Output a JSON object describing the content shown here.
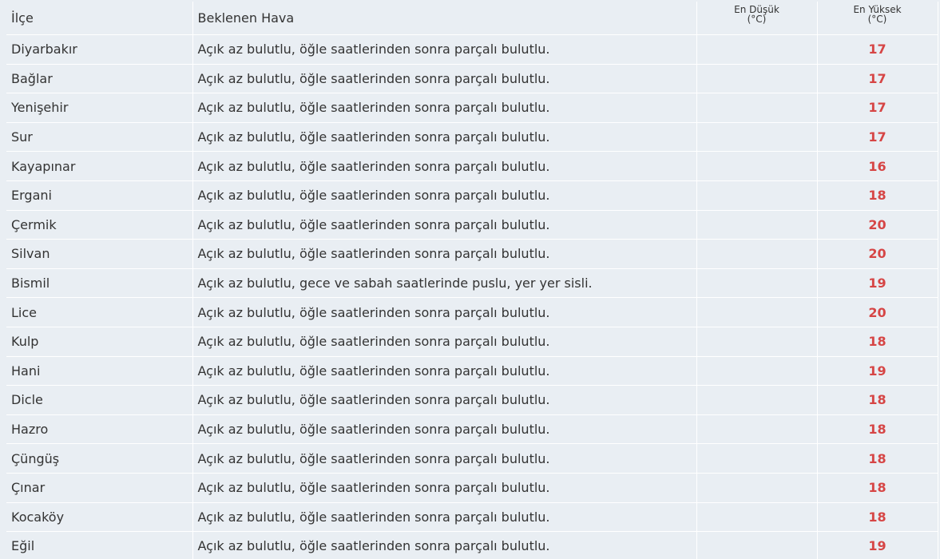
{
  "table": {
    "headers": {
      "ilce": "İlçe",
      "hava": "Beklenen Hava",
      "min_line1": "En Düşük",
      "min_line2": "(°C)",
      "max_line1": "En Yüksek",
      "max_line2": "(°C)"
    },
    "rows": [
      {
        "ilce": "Diyarbakır",
        "hava": "Açık az bulutlu, öğle saatlerinden sonra parçalı bulutlu.",
        "min": "",
        "max": "17"
      },
      {
        "ilce": "Bağlar",
        "hava": "Açık az bulutlu, öğle saatlerinden sonra parçalı bulutlu.",
        "min": "",
        "max": "17"
      },
      {
        "ilce": "Yenişehir",
        "hava": "Açık az bulutlu, öğle saatlerinden sonra parçalı bulutlu.",
        "min": "",
        "max": "17"
      },
      {
        "ilce": "Sur",
        "hava": "Açık az bulutlu, öğle saatlerinden sonra parçalı bulutlu.",
        "min": "",
        "max": "17"
      },
      {
        "ilce": "Kayapınar",
        "hava": "Açık az bulutlu, öğle saatlerinden sonra parçalı bulutlu.",
        "min": "",
        "max": "16"
      },
      {
        "ilce": "Ergani",
        "hava": "Açık az bulutlu, öğle saatlerinden sonra parçalı bulutlu.",
        "min": "",
        "max": "18"
      },
      {
        "ilce": "Çermik",
        "hava": "Açık az bulutlu, öğle saatlerinden sonra parçalı bulutlu.",
        "min": "",
        "max": "20"
      },
      {
        "ilce": "Silvan",
        "hava": "Açık az bulutlu, öğle saatlerinden sonra parçalı bulutlu.",
        "min": "",
        "max": "20"
      },
      {
        "ilce": "Bismil",
        "hava": "Açık az bulutlu, gece ve sabah saatlerinde puslu, yer yer sisli.",
        "min": "",
        "max": "19"
      },
      {
        "ilce": "Lice",
        "hava": "Açık az bulutlu, öğle saatlerinden sonra parçalı bulutlu.",
        "min": "",
        "max": "20"
      },
      {
        "ilce": "Kulp",
        "hava": "Açık az bulutlu, öğle saatlerinden sonra parçalı bulutlu.",
        "min": "",
        "max": "18"
      },
      {
        "ilce": "Hani",
        "hava": "Açık az bulutlu, öğle saatlerinden sonra parçalı bulutlu.",
        "min": "",
        "max": "19"
      },
      {
        "ilce": "Dicle",
        "hava": "Açık az bulutlu, öğle saatlerinden sonra parçalı bulutlu.",
        "min": "",
        "max": "18"
      },
      {
        "ilce": "Hazro",
        "hava": "Açık az bulutlu, öğle saatlerinden sonra parçalı bulutlu.",
        "min": "",
        "max": "18"
      },
      {
        "ilce": "Çüngüş",
        "hava": "Açık az bulutlu, öğle saatlerinden sonra parçalı bulutlu.",
        "min": "",
        "max": "18"
      },
      {
        "ilce": "Çınar",
        "hava": "Açık az bulutlu, öğle saatlerinden sonra parçalı bulutlu.",
        "min": "",
        "max": "18"
      },
      {
        "ilce": "Kocaköy",
        "hava": "Açık az bulutlu, öğle saatlerinden sonra parçalı bulutlu.",
        "min": "",
        "max": "18"
      },
      {
        "ilce": "Eğil",
        "hava": "Açık az bulutlu, öğle saatlerinden sonra parçalı bulutlu.",
        "min": "",
        "max": "19"
      }
    ]
  },
  "colors": {
    "background": "#e9eef3",
    "max_temp": "#d64545",
    "text": "#333333",
    "grid": "#ffffff"
  }
}
